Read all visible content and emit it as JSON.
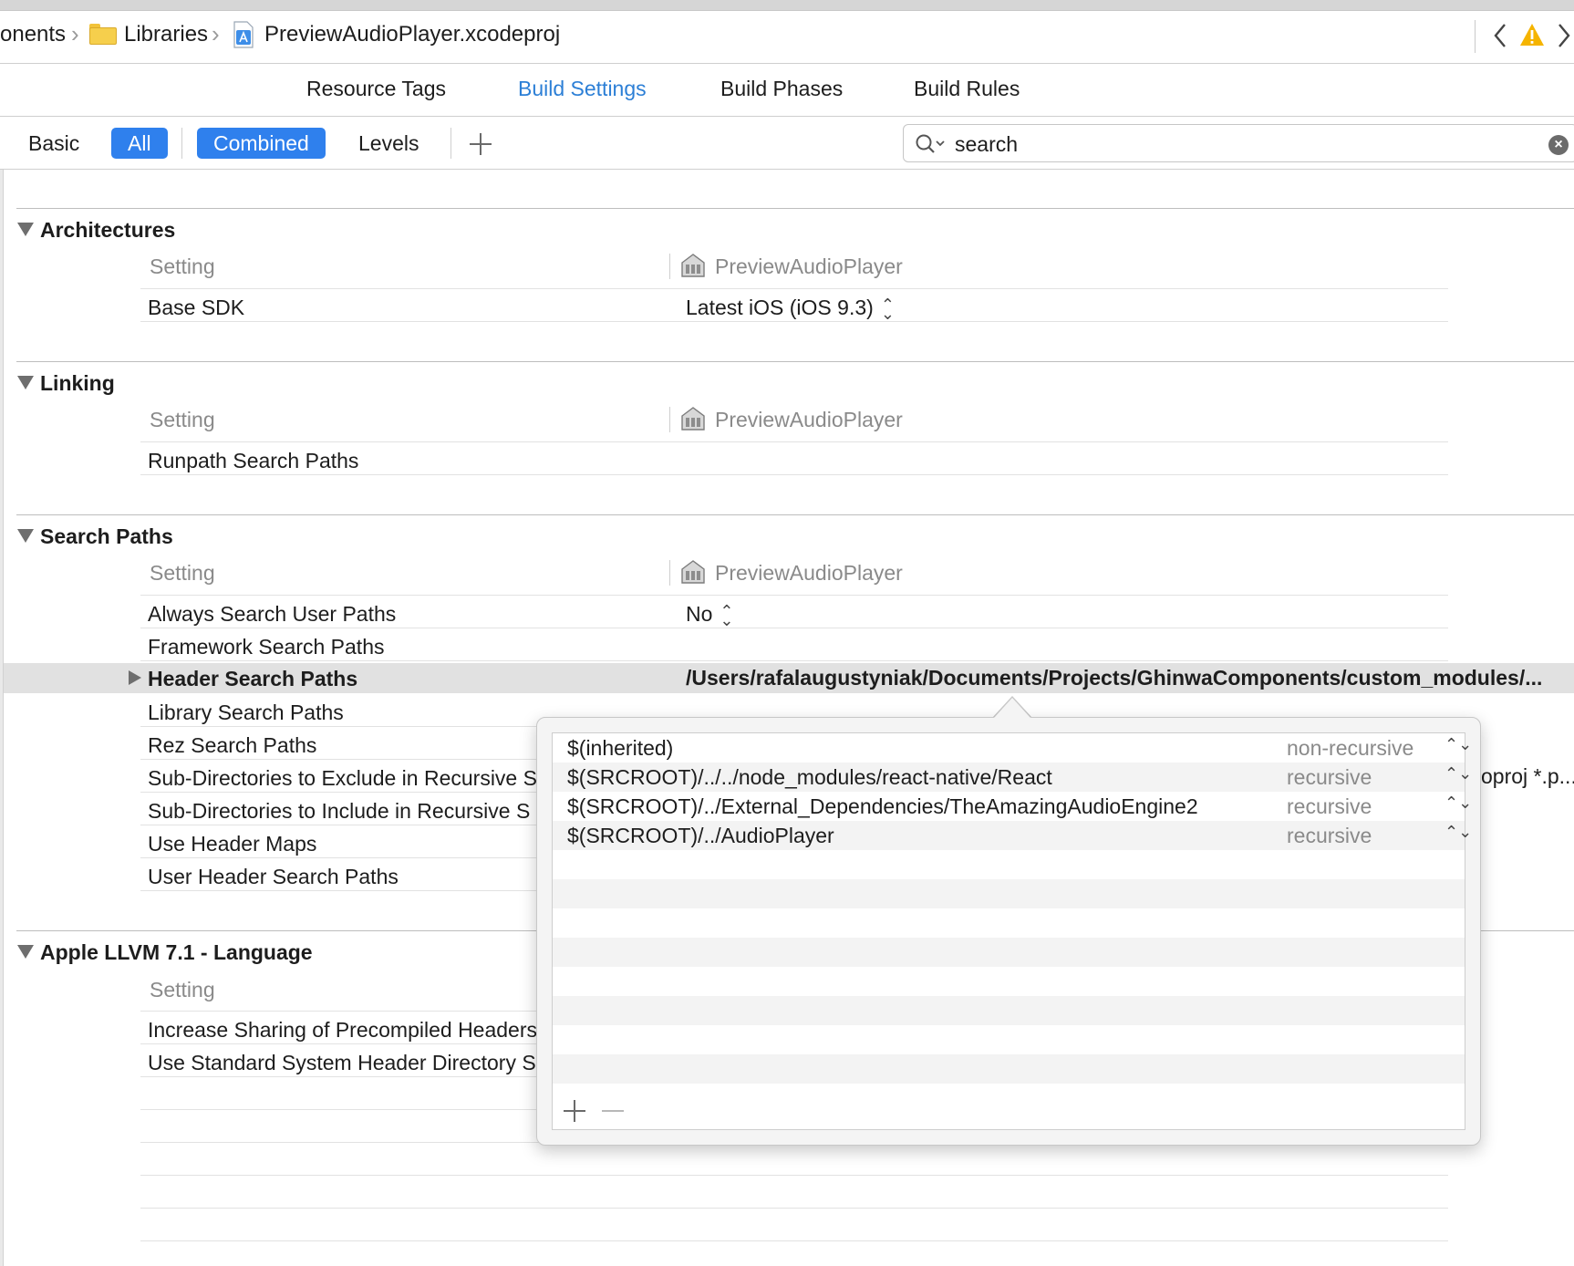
{
  "path_bar": {
    "crumb_1": "onents",
    "crumb_2": "Libraries",
    "crumb_3": "PreviewAudioPlayer.xcodeproj"
  },
  "tabs": [
    "Resource Tags",
    "Build Settings",
    "Build Phases",
    "Build Rules"
  ],
  "active_tab": "Build Settings",
  "filter": {
    "basic": "Basic",
    "all": "All",
    "combined": "Combined",
    "levels": "Levels",
    "search_value": "search"
  },
  "columns": {
    "setting": "Setting",
    "target": "PreviewAudioPlayer"
  },
  "groups": {
    "architectures": {
      "title": "Architectures",
      "rows": [
        {
          "label": "Base SDK",
          "value": "Latest iOS (iOS 9.3)"
        }
      ]
    },
    "linking": {
      "title": "Linking",
      "rows": [
        {
          "label": "Runpath Search Paths",
          "value": ""
        }
      ]
    },
    "search_paths": {
      "title": "Search Paths",
      "rows": [
        {
          "label": "Always Search User Paths",
          "value": "No"
        },
        {
          "label": "Framework Search Paths",
          "value": ""
        },
        {
          "label": "Header Search Paths",
          "value": "/Users/rafalaugustyniak/Documents/Projects/GhinwaComponents/custom_modules/..."
        },
        {
          "label": "Library Search Paths",
          "value": ""
        },
        {
          "label": "Rez Search Paths",
          "value": ""
        },
        {
          "label": "Sub-Directories to Exclude in Recursive S",
          "value": "oproj *.p..."
        },
        {
          "label": "Sub-Directories to Include in Recursive S",
          "value": ""
        },
        {
          "label": "Use Header Maps",
          "value": ""
        },
        {
          "label": "User Header Search Paths",
          "value": ""
        }
      ]
    },
    "llvm_language": {
      "title": "Apple LLVM 7.1 - Language",
      "rows": [
        {
          "label": "Increase Sharing of Precompiled Headers",
          "value": ""
        },
        {
          "label": "Use Standard System Header Directory S",
          "value": ""
        }
      ]
    }
  },
  "popover": {
    "entries": [
      {
        "path": "$(inherited)",
        "mode": "non-recursive"
      },
      {
        "path": "$(SRCROOT)/../../node_modules/react-native/React",
        "mode": "recursive"
      },
      {
        "path": "$(SRCROOT)/../External_Dependencies/TheAmazingAudioEngine2",
        "mode": "recursive"
      },
      {
        "path": "$(SRCROOT)/../AudioPlayer",
        "mode": "recursive"
      }
    ]
  },
  "colors": {
    "accent": "#2f80ed",
    "tab_active": "#2c7fd6",
    "selected_row": "#e1e1e1",
    "warning": "#f5b400"
  },
  "icons": [
    "folder-icon",
    "xcodeproj-icon",
    "back-chevron-icon",
    "warning-icon",
    "forward-chevron-icon",
    "search-icon",
    "clear-search-icon",
    "add-icon",
    "remove-icon",
    "disclosure-triangle-icon",
    "target-building-icon",
    "stepper-icon"
  ]
}
